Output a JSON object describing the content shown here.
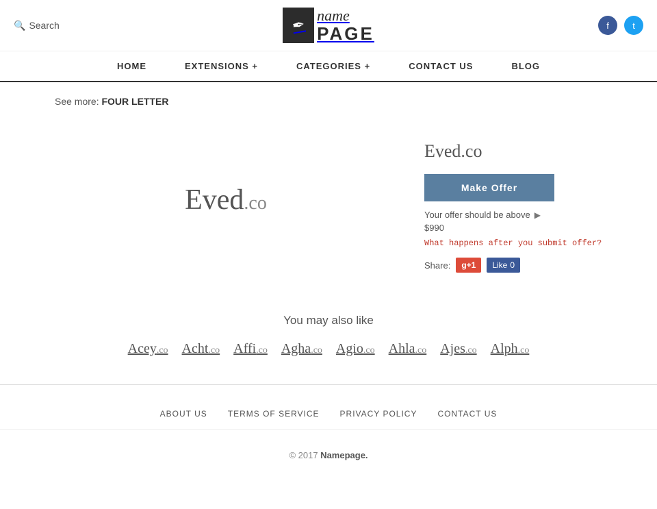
{
  "header": {
    "search_label": "Search",
    "logo_name": "name",
    "logo_page": "PAGE",
    "social": {
      "facebook_label": "f",
      "twitter_label": "t"
    }
  },
  "nav": {
    "items": [
      {
        "label": "HOME",
        "has_dropdown": false
      },
      {
        "label": "EXTENSIONS +",
        "has_dropdown": true
      },
      {
        "label": "CATEGORIES +",
        "has_dropdown": true
      },
      {
        "label": "CONTACT US",
        "has_dropdown": false
      },
      {
        "label": "BLOG",
        "has_dropdown": false
      }
    ]
  },
  "breadcrumb": {
    "prefix": "See more:",
    "link_text": "FOUR LETTER"
  },
  "domain": {
    "name": "Eved",
    "extension": ".co",
    "full_name": "Eved.co",
    "make_offer_label": "Make Offer",
    "offer_hint": "Your offer should be above",
    "offer_amount": "$990",
    "what_happens_label": "What happens after you submit offer?",
    "share_label": "Share:",
    "gplus_label": "g+1",
    "fb_label": "Like",
    "fb_count": "0"
  },
  "also_like": {
    "title": "You may also like",
    "domains": [
      {
        "name": "Acey",
        "ext": ".co"
      },
      {
        "name": "Acht",
        "ext": ".co"
      },
      {
        "name": "Affi",
        "ext": ".co"
      },
      {
        "name": "Agha",
        "ext": ".co"
      },
      {
        "name": "Agio",
        "ext": ".co"
      },
      {
        "name": "Ahla",
        "ext": ".co"
      },
      {
        "name": "Ajes",
        "ext": ".co"
      },
      {
        "name": "Alph",
        "ext": ".co"
      }
    ]
  },
  "footer": {
    "links": [
      {
        "label": "ABOUT US"
      },
      {
        "label": "TERMS OF SERVICE"
      },
      {
        "label": "PRIVACY POLICY"
      },
      {
        "label": "CONTACT US"
      }
    ],
    "copyright": "© 2017",
    "brand": "Namepage."
  }
}
